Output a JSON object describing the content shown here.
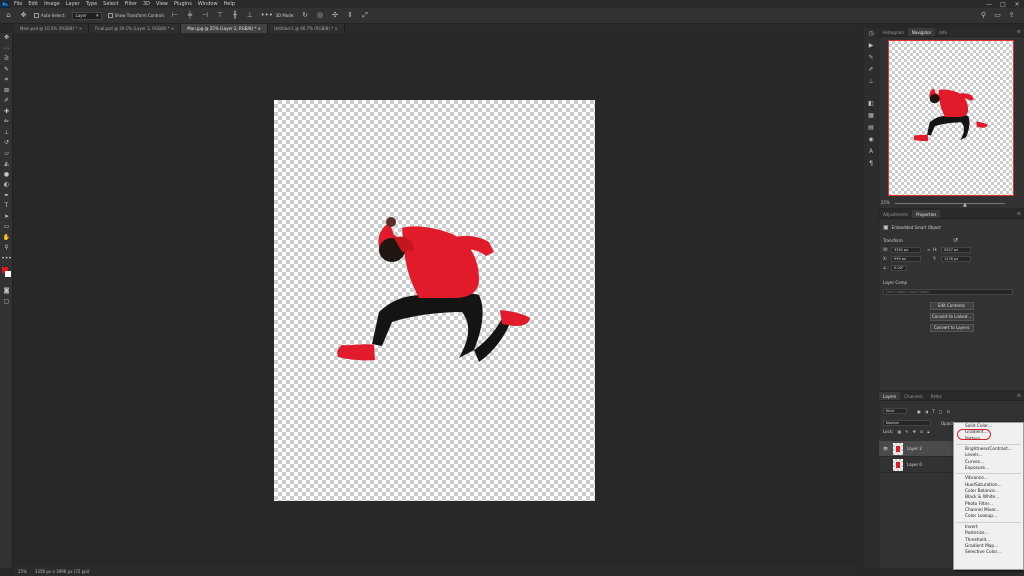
{
  "app": {
    "logo": "Ps"
  },
  "menubar": {
    "items": [
      "File",
      "Edit",
      "Image",
      "Layer",
      "Type",
      "Select",
      "Filter",
      "3D",
      "View",
      "Plugins",
      "Window",
      "Help"
    ],
    "window_controls": [
      "—",
      "□",
      "✕"
    ]
  },
  "options": {
    "auto_select_label": "Auto-Select:",
    "auto_select_target": "Layer",
    "transform_controls_label": "Show Transform Controls",
    "mode_3d": "3D Mode:"
  },
  "tabs": [
    {
      "label": "Main.psd @ 10.5% (RGB/8) *",
      "close": "×"
    },
    {
      "label": "Final.psd @ 29.1% (Layer 2, RGB/8) *",
      "close": "×"
    },
    {
      "label": "Man.jpg @ 25% (Layer 2, RGB/8) *",
      "close": "×"
    },
    {
      "label": "Untitled-1 @ 66.7% (RGB/8) *",
      "close": "×"
    }
  ],
  "status": {
    "zoom": "25%",
    "dimensions": "3356 px x 3996 px (72 ppi)"
  },
  "navigator": {
    "tabs": [
      "Histogram",
      "Navigator",
      "Info"
    ],
    "zoom": "25%"
  },
  "properties": {
    "tabs": [
      "Adjustments",
      "Properties"
    ],
    "object_type": "Embedded Smart Object",
    "transform_heading": "Transform",
    "w_label": "W:",
    "w_value": "3352 px",
    "h_label": "H:",
    "h_value": "5027 px",
    "x_label": "X:",
    "x_value": "999 px",
    "y_label": "Y:",
    "y_value": "1176 px",
    "angle": "0.00°",
    "layer_comp_heading": "Layer Comp",
    "layer_comp_placeholder": "Don't Apply Layer Comp",
    "buttons": [
      "Edit Contents",
      "Convert to Linked...",
      "Convert to Layers"
    ]
  },
  "layers_panel": {
    "tabs": [
      "Layers",
      "Channels",
      "Paths"
    ],
    "kind_label": "Kind",
    "blend_mode": "Normal",
    "opacity_label": "Opacity:",
    "lock_label": "Lock:",
    "layers": [
      {
        "name": "Layer 2",
        "visible": true,
        "active": true
      },
      {
        "name": "Layer 0",
        "visible": false,
        "active": false
      }
    ]
  },
  "context_menu": {
    "highlighted": "Gradient...",
    "groups": [
      [
        "Solid Color...",
        "Gradient...",
        "Pattern..."
      ],
      [
        "Brightness/Contrast...",
        "Levels...",
        "Curves...",
        "Exposure..."
      ],
      [
        "Vibrance...",
        "Hue/Saturation...",
        "Color Balance...",
        "Black & White...",
        "Photo Filter...",
        "Channel Mixer...",
        "Color Lookup..."
      ],
      [
        "Invert",
        "Posterize...",
        "Threshold...",
        "Gradient Map...",
        "Selective Color..."
      ]
    ]
  },
  "colors": {
    "foreground": "#e0141e",
    "background": "#ffffff",
    "accent": "#d2232a",
    "subject_red": "#e21b2b"
  }
}
